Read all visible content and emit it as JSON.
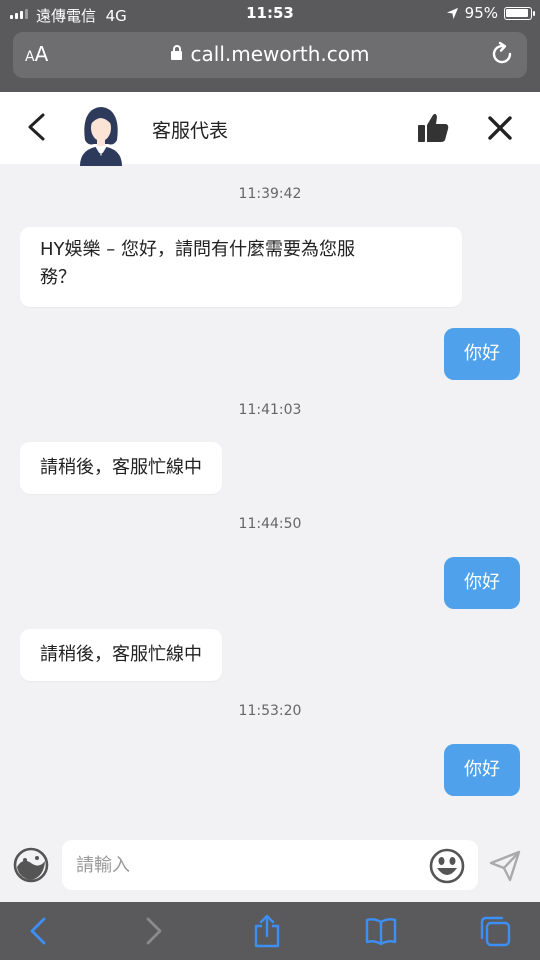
{
  "status_bar": {
    "carrier": "遠傳電信",
    "network": "4G",
    "time": "11:53",
    "battery": "95%"
  },
  "browser": {
    "text_size_label_small": "A",
    "text_size_label_large": "A",
    "url": "call.meworth.com"
  },
  "chat_header": {
    "agent_name": "客服代表"
  },
  "messages": [
    {
      "type": "timestamp",
      "text": "11:39:42"
    },
    {
      "type": "incoming",
      "line1": "HY娛樂 – 您好，請問有什麼需要為您服",
      "line2": "務？"
    },
    {
      "type": "outgoing",
      "text": "你好"
    },
    {
      "type": "timestamp",
      "text": "11:41:03"
    },
    {
      "type": "incoming",
      "text": "請稍後，客服忙線中"
    },
    {
      "type": "timestamp",
      "text": "11:44:50"
    },
    {
      "type": "outgoing",
      "text": "你好"
    },
    {
      "type": "incoming",
      "text": "請稍後，客服忙線中"
    },
    {
      "type": "timestamp",
      "text": "11:53:20"
    },
    {
      "type": "outgoing",
      "text": "你好"
    }
  ],
  "input": {
    "placeholder": "請輸入",
    "value": ""
  },
  "colors": {
    "accent": "#4ea1ea",
    "chrome": "#5a5a5c",
    "background": "#f2f2f4",
    "toolbar_icon": "#3d8ff5"
  },
  "icons": {
    "back": "chevron-left-icon",
    "like": "thumbs-up-icon",
    "close": "close-icon",
    "emoji": "emoji-icon",
    "send": "send-icon",
    "share": "share-icon",
    "bookmarks": "book-icon",
    "tabs": "tabs-icon"
  }
}
